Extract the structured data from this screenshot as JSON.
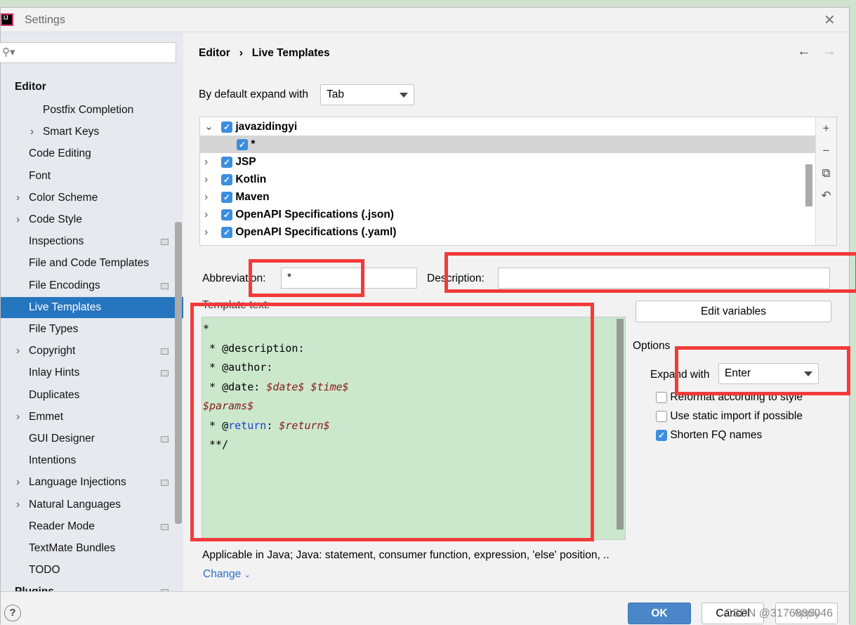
{
  "window": {
    "title": "Settings",
    "logo": "IJ"
  },
  "sidebar": {
    "search_placeholder": "",
    "items": [
      {
        "label": "Editor",
        "bold": true
      },
      {
        "label": "Postfix Completion"
      },
      {
        "label": "Smart Keys",
        "chev": true
      },
      {
        "label": "Code Editing"
      },
      {
        "label": "Font"
      },
      {
        "label": "Color Scheme",
        "chev": true
      },
      {
        "label": "Code Style",
        "chev": true
      },
      {
        "label": "Inspections",
        "page": true
      },
      {
        "label": "File and Code Templates"
      },
      {
        "label": "File Encodings",
        "page": true
      },
      {
        "label": "Live Templates",
        "selected": true
      },
      {
        "label": "File Types"
      },
      {
        "label": "Copyright",
        "chev": true,
        "page": true
      },
      {
        "label": "Inlay Hints",
        "page": true
      },
      {
        "label": "Duplicates"
      },
      {
        "label": "Emmet",
        "chev": true
      },
      {
        "label": "GUI Designer",
        "page": true
      },
      {
        "label": "Intentions"
      },
      {
        "label": "Language Injections",
        "chev": true,
        "page": true
      },
      {
        "label": "Natural Languages",
        "chev": true
      },
      {
        "label": "Reader Mode",
        "page": true
      },
      {
        "label": "TextMate Bundles"
      },
      {
        "label": "TODO"
      },
      {
        "label": "Plugins",
        "bold": true,
        "page": true
      }
    ]
  },
  "breadcrumb": {
    "parent": "Editor",
    "sep": "›",
    "current": "Live Templates"
  },
  "expand_default": {
    "label": "By default expand with",
    "value": "Tab"
  },
  "tree": [
    {
      "label": "javazidingyi",
      "expanded": true
    },
    {
      "label": "*",
      "child": true,
      "selected": true
    },
    {
      "label": "JSP"
    },
    {
      "label": "Kotlin"
    },
    {
      "label": "Maven"
    },
    {
      "label": "OpenAPI Specifications (.json)"
    },
    {
      "label": "OpenAPI Specifications (.yaml)"
    }
  ],
  "tree_tools": [
    "+",
    "−",
    "⧉",
    "↶"
  ],
  "abbreviation": {
    "label": "Abbreviation:",
    "value": "*"
  },
  "description": {
    "label": "Description:",
    "value": ""
  },
  "template_text": {
    "label": "Template text:"
  },
  "edit_variables": "Edit variables",
  "options": {
    "label": "Options",
    "expand_label": "Expand with",
    "expand_value": "Enter",
    "checks": [
      {
        "label": "Reformat according to style",
        "checked": false
      },
      {
        "label": "Use static import if possible",
        "checked": false
      },
      {
        "label": "Shorten FQ names",
        "checked": true
      }
    ]
  },
  "applicable": "Applicable in Java; Java: statement, consumer function, expression, 'else' position, ..",
  "change": "Change",
  "buttons": {
    "ok": "OK",
    "cancel": "Cancel",
    "apply": "Apply",
    "help": "?"
  },
  "watermark": "CSDN @3176886046",
  "colors": {
    "selection": "#2675bf",
    "editor_bg": "#cbe8cd",
    "highlight": "#f43a3a",
    "ok": "#4a86c8"
  }
}
